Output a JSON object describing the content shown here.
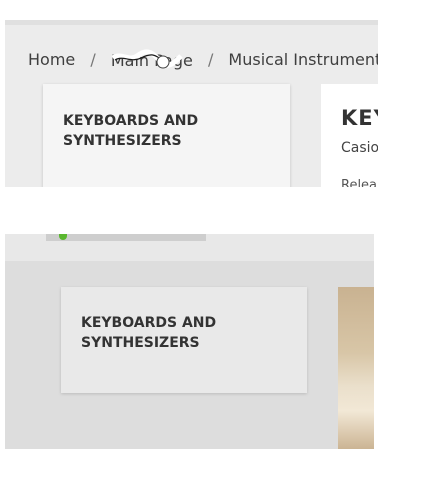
{
  "breadcrumb": {
    "items": [
      "Home",
      "Main Page",
      "Musical Instruments",
      ""
    ]
  },
  "category_card": {
    "title": "KEYBOARDS AND SYNTHESIZERS"
  },
  "product": {
    "title_partial": "KEY",
    "brand_partial": "Casio",
    "field_partial": "Relea"
  },
  "second_view": {
    "category_card_title": "KEYBOARDS AND SYNTHESIZERS"
  },
  "colors": {
    "accent_orange": "#e19b2b",
    "status_green": "#5ab72f"
  }
}
